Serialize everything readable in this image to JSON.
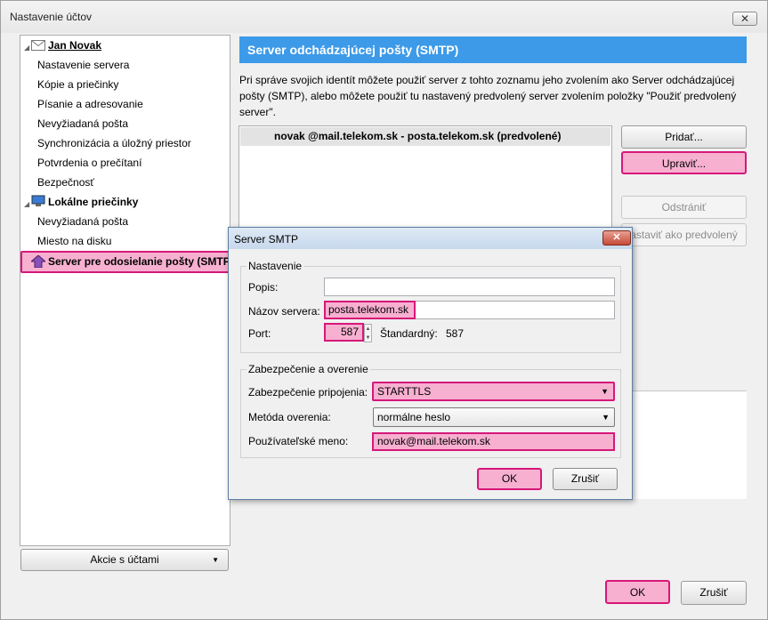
{
  "window": {
    "title": "Nastavenie účtov",
    "close_label": "✕"
  },
  "tree": {
    "account_name": "Jan Novak",
    "account_items": [
      "Nastavenie servera",
      "Kópie a priečinky",
      "Písanie a adresovanie",
      "Nevyžiadaná pošta",
      "Synchronizácia a úložný priestor",
      "Potvrdenia o prečítaní",
      "Bezpečnosť"
    ],
    "local_name": "Lokálne priečinky",
    "local_items": [
      "Nevyžiadaná pošta",
      "Miesto na disku"
    ],
    "smtp_item": "Server pre odosielanie pošty (SMTP)"
  },
  "account_actions": {
    "label": "Akcie s účtami"
  },
  "panel": {
    "heading": "Server odchádzajúcej pošty (SMTP)",
    "description": "Pri správe svojich identít môžete použiť server z tohto zoznamu jeho zvolením ako Server odchádzajúcej pošty (SMTP), alebo môžete použiť tu nastavený predvolený server zvolením položky \"Použiť predvolený server\".",
    "server_entry": "novak @mail.telekom.sk - posta.telekom.sk (predvolené)",
    "buttons": {
      "add": "Pridať...",
      "edit": "Upraviť...",
      "remove": "Odstrániť",
      "set_default": "astaviť ako predvolený"
    }
  },
  "dialog": {
    "title": "Server SMTP",
    "close_label": "✕",
    "settings_group": "Nastavenie",
    "description_label": "Popis:",
    "description_value": "",
    "server_name_label": "Názov servera:",
    "server_name_value": "posta.telekom.sk",
    "port_label": "Port:",
    "port_value": "587",
    "default_label": "Štandardný:",
    "default_value": "587",
    "security_group": "Zabezpečenie a overenie",
    "connection_security_label": "Zabezpečenie pripojenia:",
    "connection_security_value": "STARTTLS",
    "auth_method_label": "Metóda overenia:",
    "auth_method_value": "normálne heslo",
    "username_label": "Používateľské meno:",
    "username_value": "novak@mail.telekom.sk",
    "ok": "OK",
    "cancel": "Zrušiť"
  },
  "footer": {
    "ok": "OK",
    "cancel": "Zrušiť"
  }
}
